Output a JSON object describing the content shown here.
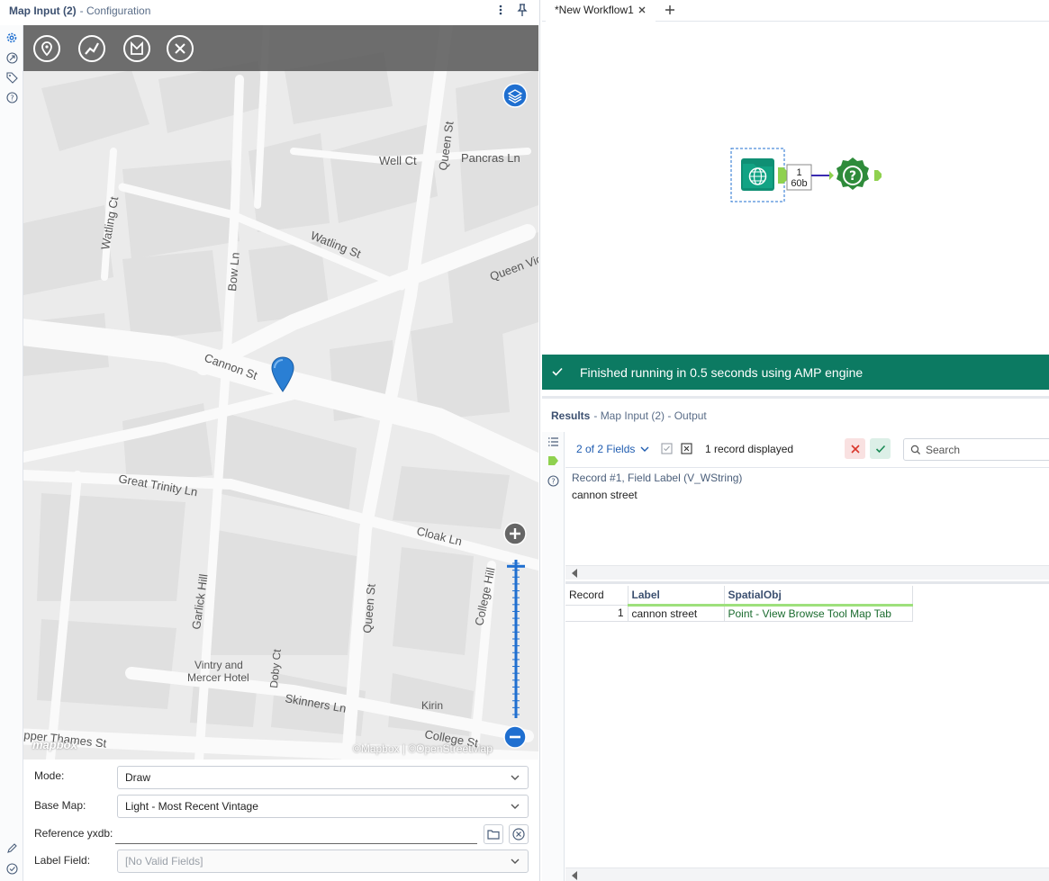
{
  "config_panel": {
    "title": "Map Input (2)",
    "subtitle": "- Configuration",
    "map": {
      "labels": {
        "well_ct": "Well Ct",
        "pancras_ln": "Pancras Ln",
        "queen_st_top": "Queen St",
        "watling_ct": "Watling Ct",
        "watling_st": "Watling St",
        "bow_ln": "Bow Ln",
        "queen_vic": "Queen Vic",
        "cannon_st": "Cannon St",
        "great_trinity_ln": "Great Trinity Ln",
        "cloak_ln": "Cloak Ln",
        "garlick_hill": "Garlick Hill",
        "queen_st_bottom": "Queen St",
        "college_hill": "College Hill",
        "vintry": "Vintry and",
        "mercer": "Mercer Hotel",
        "doby_ct": "Doby Ct",
        "skinners_ln": "Skinners Ln",
        "kirin": "Kirin",
        "college_st": "College St",
        "upper_thames": "pper Thames St"
      },
      "logo": "mapbox",
      "attribution": "©Mapbox | ©OpenStreetMap",
      "zoom_level": 0.97
    },
    "form": {
      "mode_label": "Mode:",
      "mode_value": "Draw",
      "base_map_label": "Base Map:",
      "base_map_value": "Light - Most Recent Vintage",
      "reference_label": "Reference yxdb:",
      "reference_value": "",
      "label_field_label": "Label Field:",
      "label_field_value": "[No Valid Fields]"
    }
  },
  "workflow": {
    "tab_label": "*New Workflow1",
    "connection_count": "1",
    "connection_size": "60b"
  },
  "status": {
    "message": "Finished running in 0.5 seconds using AMP engine",
    "color": "#0c7a62"
  },
  "results": {
    "title": "Results",
    "subtitle": "- Map Input (2) - Output",
    "fields_selector": "2 of 2 Fields",
    "record_count": "1 record displayed",
    "search_placeholder": "Search",
    "record_title": "Record #1, Field Label (V_WString)",
    "record_value": "cannon street",
    "columns": [
      "Record",
      "Label",
      "SpatialObj"
    ],
    "rows": [
      {
        "record": "1",
        "label": "cannon street",
        "spatial": "Point - View Browse Tool Map Tab"
      }
    ]
  }
}
